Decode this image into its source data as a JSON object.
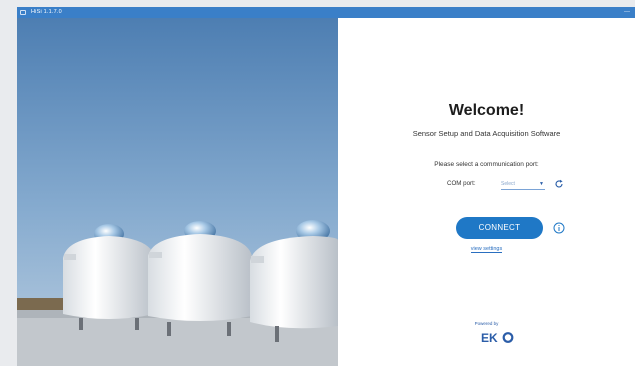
{
  "window": {
    "title": "HiSi 1.1.7.0",
    "controls": "—"
  },
  "panel": {
    "welcome": "Welcome!",
    "subtitle": "Sensor Setup and Data Acquisition Software",
    "prompt": "Please select a communication port:",
    "com_label": "COM port:",
    "com_select_value": "Select",
    "connect_label": "CONNECT",
    "view_settings": "view settings",
    "powered_by": "Powered by",
    "brand": "EKO"
  },
  "icons": {
    "app": "app-icon",
    "dropdown": "chevron-down-icon",
    "refresh": "refresh-icon",
    "info": "info-icon"
  },
  "colors": {
    "titlebar": "#3a7fc8",
    "accent": "#1f78c6",
    "brand": "#2b5da8"
  }
}
